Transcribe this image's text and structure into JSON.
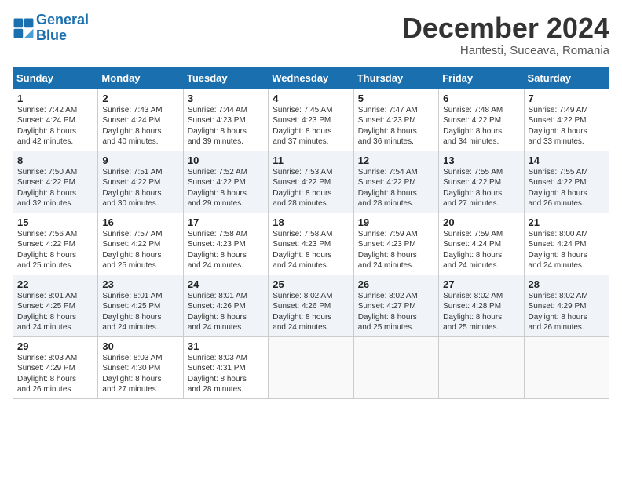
{
  "header": {
    "logo_line1": "General",
    "logo_line2": "Blue",
    "month": "December 2024",
    "location": "Hantesti, Suceava, Romania"
  },
  "weekdays": [
    "Sunday",
    "Monday",
    "Tuesday",
    "Wednesday",
    "Thursday",
    "Friday",
    "Saturday"
  ],
  "weeks": [
    [
      {
        "day": "1",
        "info": "Sunrise: 7:42 AM\nSunset: 4:24 PM\nDaylight: 8 hours\nand 42 minutes."
      },
      {
        "day": "2",
        "info": "Sunrise: 7:43 AM\nSunset: 4:24 PM\nDaylight: 8 hours\nand 40 minutes."
      },
      {
        "day": "3",
        "info": "Sunrise: 7:44 AM\nSunset: 4:23 PM\nDaylight: 8 hours\nand 39 minutes."
      },
      {
        "day": "4",
        "info": "Sunrise: 7:45 AM\nSunset: 4:23 PM\nDaylight: 8 hours\nand 37 minutes."
      },
      {
        "day": "5",
        "info": "Sunrise: 7:47 AM\nSunset: 4:23 PM\nDaylight: 8 hours\nand 36 minutes."
      },
      {
        "day": "6",
        "info": "Sunrise: 7:48 AM\nSunset: 4:22 PM\nDaylight: 8 hours\nand 34 minutes."
      },
      {
        "day": "7",
        "info": "Sunrise: 7:49 AM\nSunset: 4:22 PM\nDaylight: 8 hours\nand 33 minutes."
      }
    ],
    [
      {
        "day": "8",
        "info": "Sunrise: 7:50 AM\nSunset: 4:22 PM\nDaylight: 8 hours\nand 32 minutes."
      },
      {
        "day": "9",
        "info": "Sunrise: 7:51 AM\nSunset: 4:22 PM\nDaylight: 8 hours\nand 30 minutes."
      },
      {
        "day": "10",
        "info": "Sunrise: 7:52 AM\nSunset: 4:22 PM\nDaylight: 8 hours\nand 29 minutes."
      },
      {
        "day": "11",
        "info": "Sunrise: 7:53 AM\nSunset: 4:22 PM\nDaylight: 8 hours\nand 28 minutes."
      },
      {
        "day": "12",
        "info": "Sunrise: 7:54 AM\nSunset: 4:22 PM\nDaylight: 8 hours\nand 28 minutes."
      },
      {
        "day": "13",
        "info": "Sunrise: 7:55 AM\nSunset: 4:22 PM\nDaylight: 8 hours\nand 27 minutes."
      },
      {
        "day": "14",
        "info": "Sunrise: 7:55 AM\nSunset: 4:22 PM\nDaylight: 8 hours\nand 26 minutes."
      }
    ],
    [
      {
        "day": "15",
        "info": "Sunrise: 7:56 AM\nSunset: 4:22 PM\nDaylight: 8 hours\nand 25 minutes."
      },
      {
        "day": "16",
        "info": "Sunrise: 7:57 AM\nSunset: 4:22 PM\nDaylight: 8 hours\nand 25 minutes."
      },
      {
        "day": "17",
        "info": "Sunrise: 7:58 AM\nSunset: 4:23 PM\nDaylight: 8 hours\nand 24 minutes."
      },
      {
        "day": "18",
        "info": "Sunrise: 7:58 AM\nSunset: 4:23 PM\nDaylight: 8 hours\nand 24 minutes."
      },
      {
        "day": "19",
        "info": "Sunrise: 7:59 AM\nSunset: 4:23 PM\nDaylight: 8 hours\nand 24 minutes."
      },
      {
        "day": "20",
        "info": "Sunrise: 7:59 AM\nSunset: 4:24 PM\nDaylight: 8 hours\nand 24 minutes."
      },
      {
        "day": "21",
        "info": "Sunrise: 8:00 AM\nSunset: 4:24 PM\nDaylight: 8 hours\nand 24 minutes."
      }
    ],
    [
      {
        "day": "22",
        "info": "Sunrise: 8:01 AM\nSunset: 4:25 PM\nDaylight: 8 hours\nand 24 minutes."
      },
      {
        "day": "23",
        "info": "Sunrise: 8:01 AM\nSunset: 4:25 PM\nDaylight: 8 hours\nand 24 minutes."
      },
      {
        "day": "24",
        "info": "Sunrise: 8:01 AM\nSunset: 4:26 PM\nDaylight: 8 hours\nand 24 minutes."
      },
      {
        "day": "25",
        "info": "Sunrise: 8:02 AM\nSunset: 4:26 PM\nDaylight: 8 hours\nand 24 minutes."
      },
      {
        "day": "26",
        "info": "Sunrise: 8:02 AM\nSunset: 4:27 PM\nDaylight: 8 hours\nand 25 minutes."
      },
      {
        "day": "27",
        "info": "Sunrise: 8:02 AM\nSunset: 4:28 PM\nDaylight: 8 hours\nand 25 minutes."
      },
      {
        "day": "28",
        "info": "Sunrise: 8:02 AM\nSunset: 4:29 PM\nDaylight: 8 hours\nand 26 minutes."
      }
    ],
    [
      {
        "day": "29",
        "info": "Sunrise: 8:03 AM\nSunset: 4:29 PM\nDaylight: 8 hours\nand 26 minutes."
      },
      {
        "day": "30",
        "info": "Sunrise: 8:03 AM\nSunset: 4:30 PM\nDaylight: 8 hours\nand 27 minutes."
      },
      {
        "day": "31",
        "info": "Sunrise: 8:03 AM\nSunset: 4:31 PM\nDaylight: 8 hours\nand 28 minutes."
      },
      {
        "day": "",
        "info": ""
      },
      {
        "day": "",
        "info": ""
      },
      {
        "day": "",
        "info": ""
      },
      {
        "day": "",
        "info": ""
      }
    ]
  ]
}
